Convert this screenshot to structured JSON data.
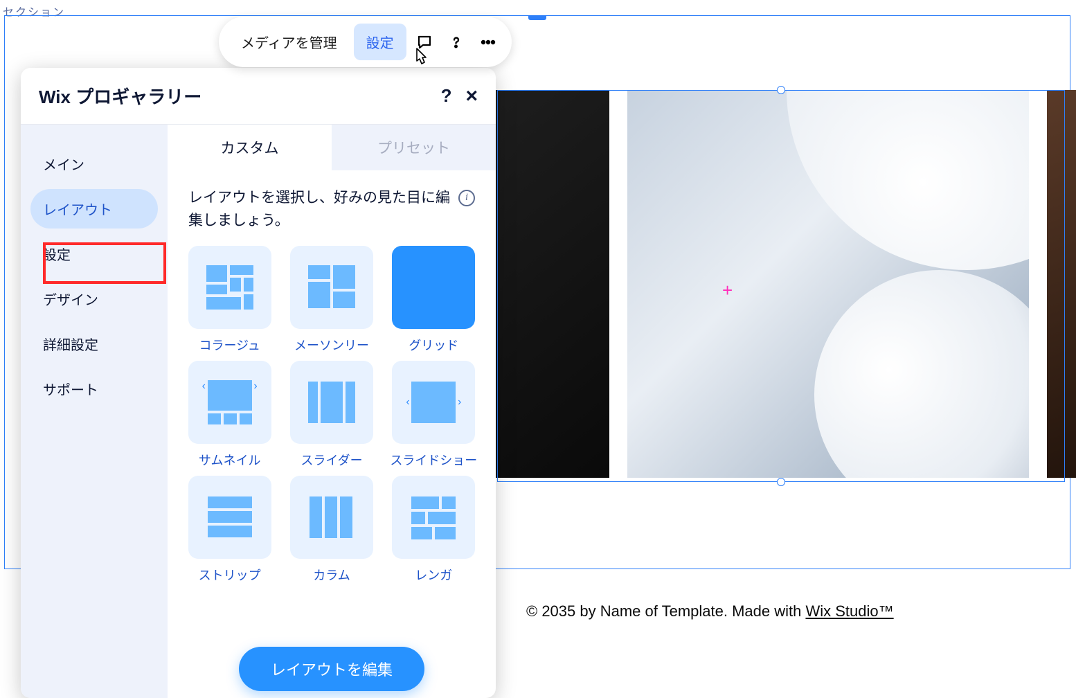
{
  "top_label": "セクション",
  "toolbar": {
    "manage_media": "メディアを管理",
    "settings": "設定",
    "settings_active": true
  },
  "panel": {
    "title": "Wix プロギャラリー",
    "help_symbol": "?",
    "close_symbol": "×"
  },
  "sidebar": {
    "items": [
      {
        "label": "メイン"
      },
      {
        "label": "レイアウト",
        "selected": true,
        "highlighted": true
      },
      {
        "label": "設定"
      },
      {
        "label": "デザイン"
      },
      {
        "label": "詳細設定"
      },
      {
        "label": "サポート"
      }
    ]
  },
  "tabs": {
    "custom": "カスタム",
    "preset": "プリセット",
    "active": "custom"
  },
  "description": "レイアウトを選択し、好みの見た目に編集しましょう。",
  "layouts": [
    {
      "id": "collage",
      "label": "コラージュ"
    },
    {
      "id": "masonry",
      "label": "メーソンリー"
    },
    {
      "id": "grid",
      "label": "グリッド",
      "selected": true
    },
    {
      "id": "thumbnail",
      "label": "サムネイル"
    },
    {
      "id": "slider",
      "label": "スライダー"
    },
    {
      "id": "slideshow",
      "label": "スライドショー"
    },
    {
      "id": "strip",
      "label": "ストリップ"
    },
    {
      "id": "column",
      "label": "カラム"
    },
    {
      "id": "brick",
      "label": "レンガ"
    }
  ],
  "edit_layout_button": "レイアウトを編集",
  "footer": {
    "prefix": "© 2035 by Name of Template. Made with ",
    "link": "Wix Studio™"
  }
}
